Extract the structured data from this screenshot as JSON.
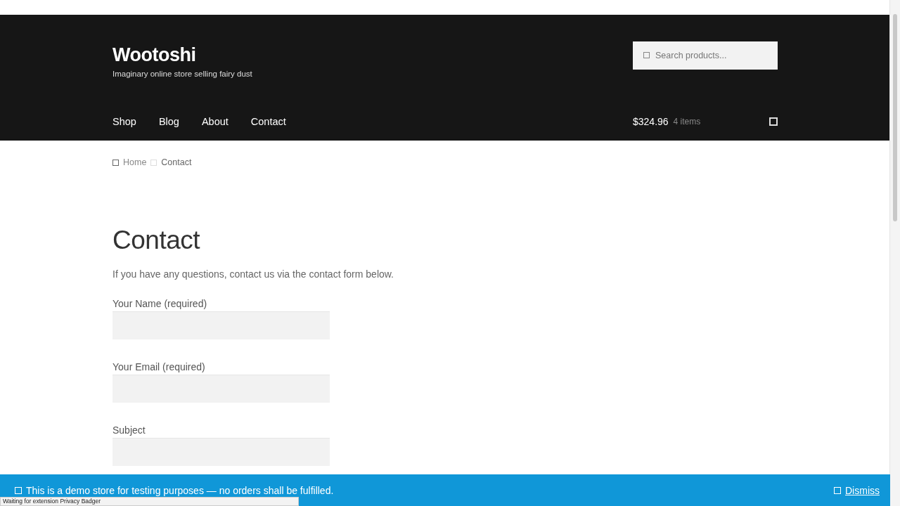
{
  "site": {
    "title": "Wootoshi",
    "tagline": "Imaginary online store selling fairy dust"
  },
  "search": {
    "placeholder": "Search products..."
  },
  "nav": [
    {
      "label": "Shop"
    },
    {
      "label": "Blog"
    },
    {
      "label": "About"
    },
    {
      "label": "Contact"
    }
  ],
  "cart": {
    "total": "$324.96",
    "count": "4 items"
  },
  "breadcrumb": [
    {
      "label": "Home"
    },
    {
      "label": "Contact"
    }
  ],
  "page": {
    "title": "Contact",
    "intro": "If you have any questions, contact us via the contact form below."
  },
  "form": {
    "fields": [
      {
        "label": "Your Name (required)"
      },
      {
        "label": "Your Email (required)"
      },
      {
        "label": "Subject"
      }
    ]
  },
  "notice": {
    "text": "This is a demo store for testing purposes — no orders shall be fulfilled.",
    "dismiss": "Dismiss"
  },
  "status_bar": {
    "text": "Waiting for extension Privacy Badger"
  }
}
